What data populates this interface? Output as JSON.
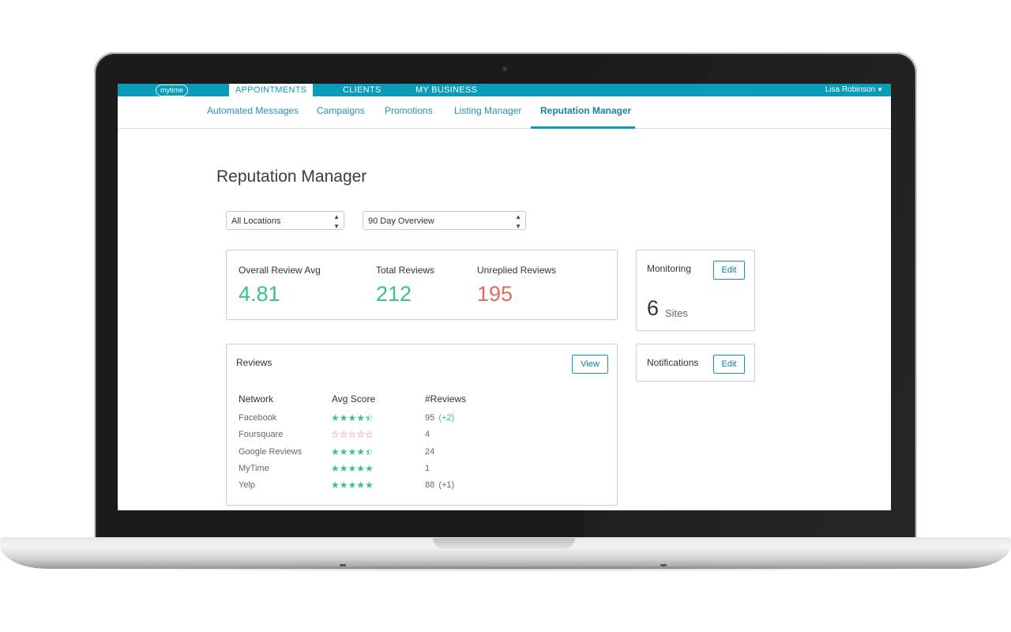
{
  "brand": {
    "logo_text": "mytime"
  },
  "topbar": {
    "nav": [
      "APPOINTMENTS",
      "CLIENTS",
      "MY BUSINESS"
    ],
    "user_name": "Lisa Robinson"
  },
  "subnav": {
    "tabs": [
      "Automated Messages",
      "Campaigns",
      "Promotions",
      "Listing Manager",
      "Reputation Manager"
    ],
    "active": "Reputation Manager"
  },
  "page": {
    "title": "Reputation Manager"
  },
  "filters": {
    "location": "All Locations",
    "period": "90 Day Overview"
  },
  "summary": {
    "overall_label": "Overall Review Avg",
    "overall_value": "4.81",
    "total_label": "Total Reviews",
    "total_value": "212",
    "unreplied_label": "Unreplied Reviews",
    "unreplied_value": "195"
  },
  "monitoring": {
    "title": "Monitoring",
    "edit_label": "Edit",
    "count": "6",
    "unit": "Sites"
  },
  "notifications": {
    "title": "Notifications",
    "edit_label": "Edit"
  },
  "reviews": {
    "title": "Reviews",
    "view_label": "View",
    "headers": [
      "Network",
      "Avg Score",
      "#Reviews"
    ],
    "rows": [
      {
        "network": "Facebook",
        "stars": 4.5,
        "count": "95",
        "delta": "(+2)"
      },
      {
        "network": "Foursquare",
        "stars": 0,
        "count": "4",
        "delta": ""
      },
      {
        "network": "Google Reviews",
        "stars": 4.5,
        "count": "24",
        "delta": ""
      },
      {
        "network": "MyTime",
        "stars": 5,
        "count": "1",
        "delta": ""
      },
      {
        "network": "Yelp",
        "stars": 5,
        "count": "88",
        "delta": "(+1)"
      }
    ]
  },
  "colors": {
    "brand_teal": "#0a9bb8",
    "positive_green": "#3bbf8c",
    "negative_red": "#e36a62"
  }
}
